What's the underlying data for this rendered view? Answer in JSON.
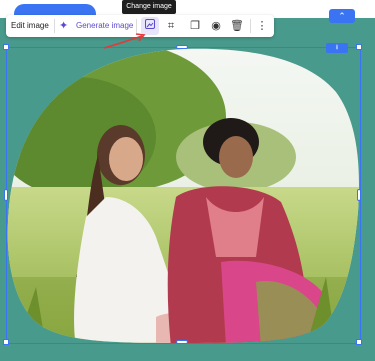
{
  "toolbar": {
    "edit_label": "Edit image",
    "generate_label": "Generate image",
    "icons": [
      "change-image-icon",
      "crop-icon",
      "copy-icon",
      "eye-icon",
      "trash-icon",
      "more-icon"
    ]
  },
  "tooltip": {
    "text": "Change image"
  },
  "colors": {
    "canvas_bg": "#489a8c",
    "accent": "#3a74f2",
    "ai_purple": "#5a4ad1",
    "annotation_red": "#e23a3a"
  }
}
